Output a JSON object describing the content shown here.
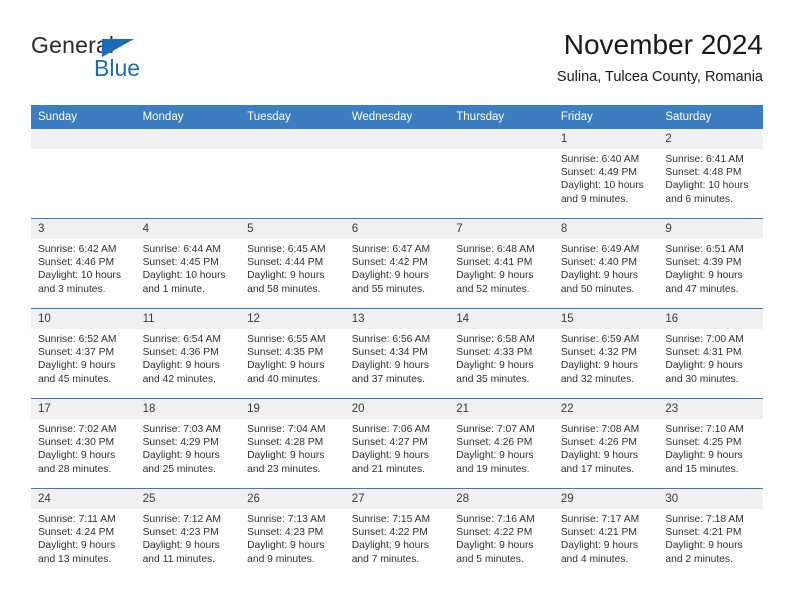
{
  "brand": {
    "name_part1": "General",
    "name_part2": "Blue",
    "logo_icon": "triangle-logo-icon",
    "accent_color": "#1b6cb5"
  },
  "header": {
    "title": "November 2024",
    "subtitle": "Sulina, Tulcea County, Romania"
  },
  "calendar": {
    "header_bg": "#3b7dbf",
    "daynum_bg": "#f0f0f0",
    "weekday_headers": [
      "Sunday",
      "Monday",
      "Tuesday",
      "Wednesday",
      "Thursday",
      "Friday",
      "Saturday"
    ],
    "weeks": [
      [
        {
          "day": "",
          "empty": true
        },
        {
          "day": "",
          "empty": true
        },
        {
          "day": "",
          "empty": true
        },
        {
          "day": "",
          "empty": true
        },
        {
          "day": "",
          "empty": true
        },
        {
          "day": "1",
          "sunrise": "Sunrise: 6:40 AM",
          "sunset": "Sunset: 4:49 PM",
          "daylight1": "Daylight: 10 hours",
          "daylight2": "and 9 minutes."
        },
        {
          "day": "2",
          "sunrise": "Sunrise: 6:41 AM",
          "sunset": "Sunset: 4:48 PM",
          "daylight1": "Daylight: 10 hours",
          "daylight2": "and 6 minutes."
        }
      ],
      [
        {
          "day": "3",
          "sunrise": "Sunrise: 6:42 AM",
          "sunset": "Sunset: 4:46 PM",
          "daylight1": "Daylight: 10 hours",
          "daylight2": "and 3 minutes."
        },
        {
          "day": "4",
          "sunrise": "Sunrise: 6:44 AM",
          "sunset": "Sunset: 4:45 PM",
          "daylight1": "Daylight: 10 hours",
          "daylight2": "and 1 minute."
        },
        {
          "day": "5",
          "sunrise": "Sunrise: 6:45 AM",
          "sunset": "Sunset: 4:44 PM",
          "daylight1": "Daylight: 9 hours",
          "daylight2": "and 58 minutes."
        },
        {
          "day": "6",
          "sunrise": "Sunrise: 6:47 AM",
          "sunset": "Sunset: 4:42 PM",
          "daylight1": "Daylight: 9 hours",
          "daylight2": "and 55 minutes."
        },
        {
          "day": "7",
          "sunrise": "Sunrise: 6:48 AM",
          "sunset": "Sunset: 4:41 PM",
          "daylight1": "Daylight: 9 hours",
          "daylight2": "and 52 minutes."
        },
        {
          "day": "8",
          "sunrise": "Sunrise: 6:49 AM",
          "sunset": "Sunset: 4:40 PM",
          "daylight1": "Daylight: 9 hours",
          "daylight2": "and 50 minutes."
        },
        {
          "day": "9",
          "sunrise": "Sunrise: 6:51 AM",
          "sunset": "Sunset: 4:39 PM",
          "daylight1": "Daylight: 9 hours",
          "daylight2": "and 47 minutes."
        }
      ],
      [
        {
          "day": "10",
          "sunrise": "Sunrise: 6:52 AM",
          "sunset": "Sunset: 4:37 PM",
          "daylight1": "Daylight: 9 hours",
          "daylight2": "and 45 minutes."
        },
        {
          "day": "11",
          "sunrise": "Sunrise: 6:54 AM",
          "sunset": "Sunset: 4:36 PM",
          "daylight1": "Daylight: 9 hours",
          "daylight2": "and 42 minutes."
        },
        {
          "day": "12",
          "sunrise": "Sunrise: 6:55 AM",
          "sunset": "Sunset: 4:35 PM",
          "daylight1": "Daylight: 9 hours",
          "daylight2": "and 40 minutes."
        },
        {
          "day": "13",
          "sunrise": "Sunrise: 6:56 AM",
          "sunset": "Sunset: 4:34 PM",
          "daylight1": "Daylight: 9 hours",
          "daylight2": "and 37 minutes."
        },
        {
          "day": "14",
          "sunrise": "Sunrise: 6:58 AM",
          "sunset": "Sunset: 4:33 PM",
          "daylight1": "Daylight: 9 hours",
          "daylight2": "and 35 minutes."
        },
        {
          "day": "15",
          "sunrise": "Sunrise: 6:59 AM",
          "sunset": "Sunset: 4:32 PM",
          "daylight1": "Daylight: 9 hours",
          "daylight2": "and 32 minutes."
        },
        {
          "day": "16",
          "sunrise": "Sunrise: 7:00 AM",
          "sunset": "Sunset: 4:31 PM",
          "daylight1": "Daylight: 9 hours",
          "daylight2": "and 30 minutes."
        }
      ],
      [
        {
          "day": "17",
          "sunrise": "Sunrise: 7:02 AM",
          "sunset": "Sunset: 4:30 PM",
          "daylight1": "Daylight: 9 hours",
          "daylight2": "and 28 minutes."
        },
        {
          "day": "18",
          "sunrise": "Sunrise: 7:03 AM",
          "sunset": "Sunset: 4:29 PM",
          "daylight1": "Daylight: 9 hours",
          "daylight2": "and 25 minutes."
        },
        {
          "day": "19",
          "sunrise": "Sunrise: 7:04 AM",
          "sunset": "Sunset: 4:28 PM",
          "daylight1": "Daylight: 9 hours",
          "daylight2": "and 23 minutes."
        },
        {
          "day": "20",
          "sunrise": "Sunrise: 7:06 AM",
          "sunset": "Sunset: 4:27 PM",
          "daylight1": "Daylight: 9 hours",
          "daylight2": "and 21 minutes."
        },
        {
          "day": "21",
          "sunrise": "Sunrise: 7:07 AM",
          "sunset": "Sunset: 4:26 PM",
          "daylight1": "Daylight: 9 hours",
          "daylight2": "and 19 minutes."
        },
        {
          "day": "22",
          "sunrise": "Sunrise: 7:08 AM",
          "sunset": "Sunset: 4:26 PM",
          "daylight1": "Daylight: 9 hours",
          "daylight2": "and 17 minutes."
        },
        {
          "day": "23",
          "sunrise": "Sunrise: 7:10 AM",
          "sunset": "Sunset: 4:25 PM",
          "daylight1": "Daylight: 9 hours",
          "daylight2": "and 15 minutes."
        }
      ],
      [
        {
          "day": "24",
          "sunrise": "Sunrise: 7:11 AM",
          "sunset": "Sunset: 4:24 PM",
          "daylight1": "Daylight: 9 hours",
          "daylight2": "and 13 minutes."
        },
        {
          "day": "25",
          "sunrise": "Sunrise: 7:12 AM",
          "sunset": "Sunset: 4:23 PM",
          "daylight1": "Daylight: 9 hours",
          "daylight2": "and 11 minutes."
        },
        {
          "day": "26",
          "sunrise": "Sunrise: 7:13 AM",
          "sunset": "Sunset: 4:23 PM",
          "daylight1": "Daylight: 9 hours",
          "daylight2": "and 9 minutes."
        },
        {
          "day": "27",
          "sunrise": "Sunrise: 7:15 AM",
          "sunset": "Sunset: 4:22 PM",
          "daylight1": "Daylight: 9 hours",
          "daylight2": "and 7 minutes."
        },
        {
          "day": "28",
          "sunrise": "Sunrise: 7:16 AM",
          "sunset": "Sunset: 4:22 PM",
          "daylight1": "Daylight: 9 hours",
          "daylight2": "and 5 minutes."
        },
        {
          "day": "29",
          "sunrise": "Sunrise: 7:17 AM",
          "sunset": "Sunset: 4:21 PM",
          "daylight1": "Daylight: 9 hours",
          "daylight2": "and 4 minutes."
        },
        {
          "day": "30",
          "sunrise": "Sunrise: 7:18 AM",
          "sunset": "Sunset: 4:21 PM",
          "daylight1": "Daylight: 9 hours",
          "daylight2": "and 2 minutes."
        }
      ]
    ]
  }
}
